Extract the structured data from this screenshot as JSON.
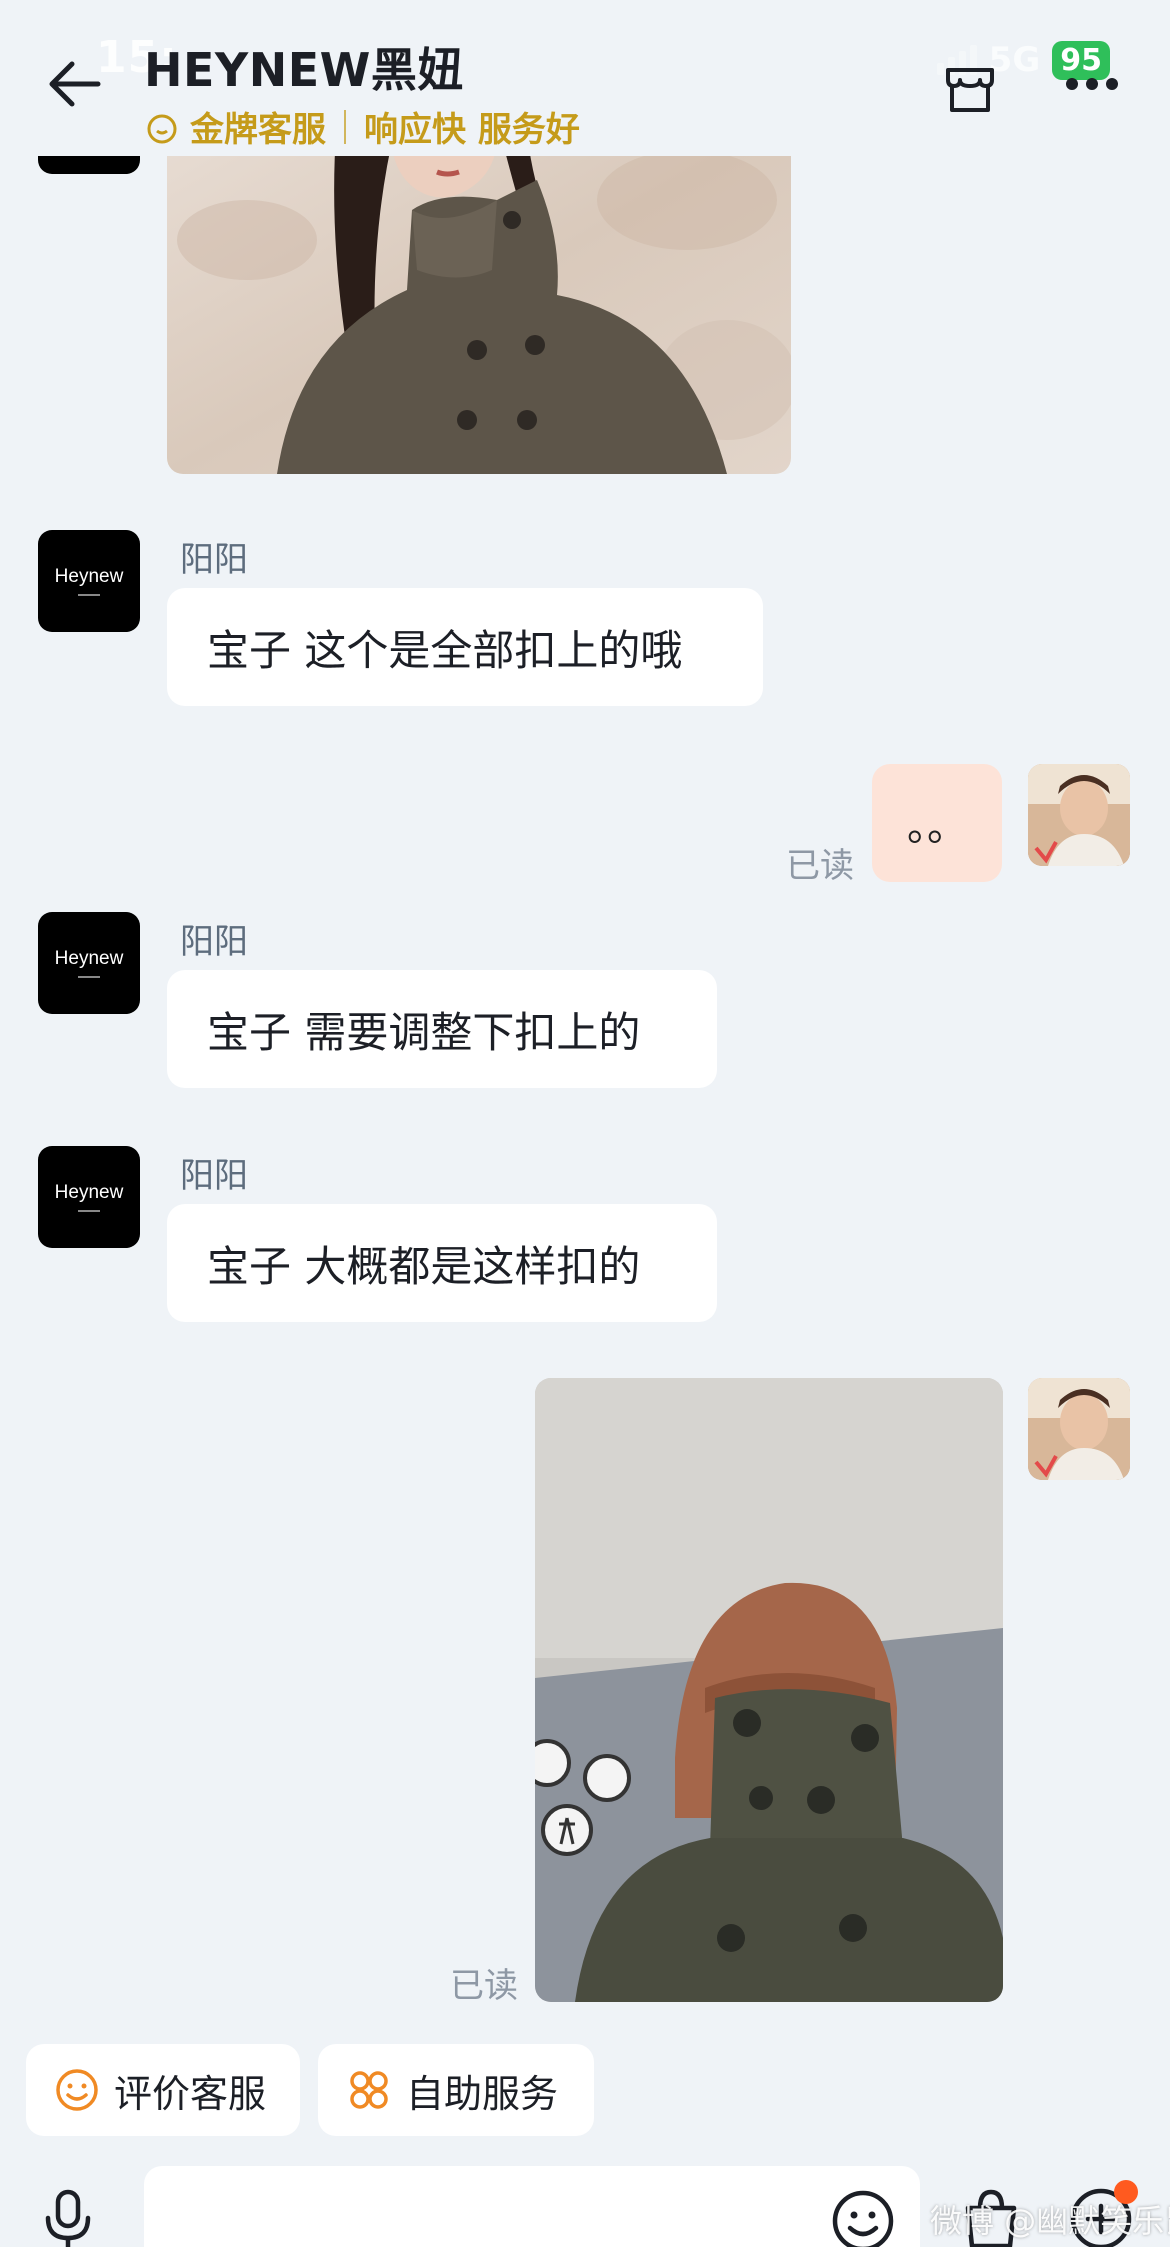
{
  "status_bar": {
    "time": "15:",
    "network": "5G",
    "battery": "95"
  },
  "header": {
    "title": "HEYNEW黑妞",
    "badge": "金牌客服",
    "tagline": "响应快 服务好"
  },
  "agent": {
    "name": "阳阳",
    "avatar_text": "Heynew"
  },
  "messages": [
    {
      "from": "agent",
      "type": "image",
      "desc": "model wearing grey funnel-neck wool coat"
    },
    {
      "from": "agent",
      "type": "text",
      "text": "宝子 这个是全部扣上的哦"
    },
    {
      "from": "user",
      "type": "sticker",
      "text": "。。",
      "status": "已读"
    },
    {
      "from": "agent",
      "type": "text",
      "text": "宝子 需要调整下扣上的"
    },
    {
      "from": "agent",
      "type": "text",
      "text": "宝子 大概都是这样扣的"
    },
    {
      "from": "user",
      "type": "image",
      "status": "已读"
    }
  ],
  "quick_actions": [
    {
      "label": "评价客服",
      "icon": "smile-icon"
    },
    {
      "label": "自助服务",
      "icon": "grid-icon"
    }
  ],
  "input": {
    "placeholder": ""
  },
  "watermark": "微博 @幽默笑乐鼠",
  "colors": {
    "accent_gold": "#c59b1a",
    "orange": "#f08a24",
    "background": "#eff3f7"
  }
}
